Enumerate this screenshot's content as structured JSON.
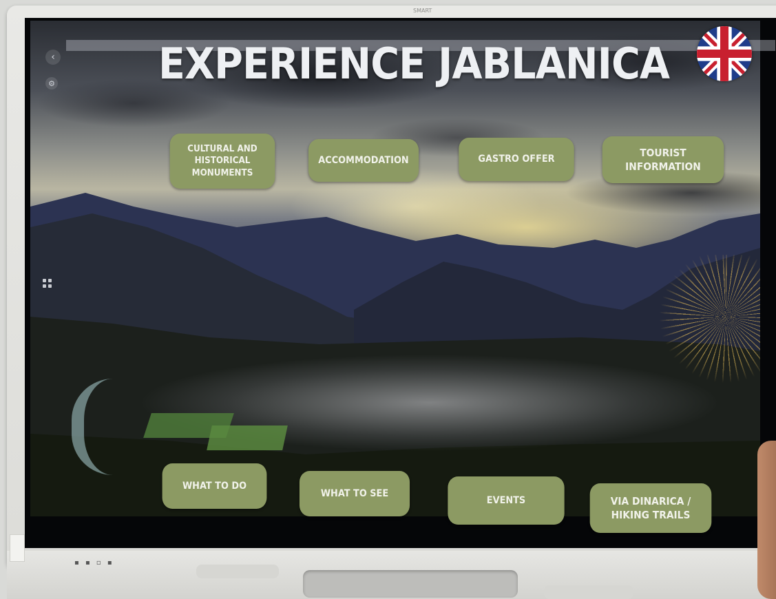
{
  "device": {
    "brand_label": "SMART"
  },
  "app": {
    "title": "EXPERIENCE JABLANICA",
    "language_flag": "uk-flag-icon"
  },
  "top_buttons": [
    {
      "label": "CULTURAL AND\nHISTORICAL\nMONUMENTS"
    },
    {
      "label": "ACCOMMODATION"
    },
    {
      "label": "GASTRO OFFER"
    },
    {
      "label": "TOURIST\nINFORMATION"
    }
  ],
  "bottom_buttons": [
    {
      "label": "WHAT TO DO"
    },
    {
      "label": "WHAT TO SEE"
    },
    {
      "label": "EVENTS"
    },
    {
      "label": "VIA DINARICA /\nHIKING TRAILS"
    }
  ],
  "sidebar": {
    "back_icon": "back-arrow-icon",
    "settings_icon": "gear-icon",
    "apps_icon": "grid-icon"
  },
  "colors": {
    "button_bg": "#8c9a63",
    "button_text": "#f1f2ea",
    "title_text": "#eef0f3"
  }
}
